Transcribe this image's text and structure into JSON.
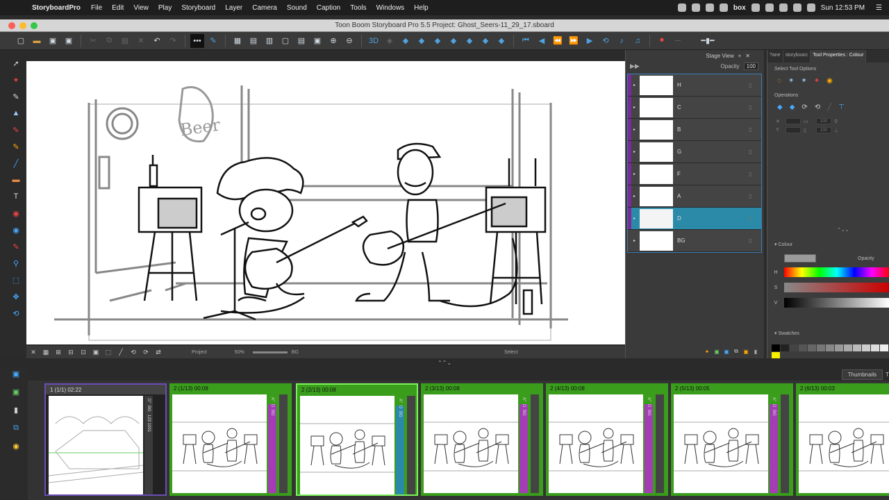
{
  "menubar": {
    "app_name": "StoryboardPro",
    "items": [
      "File",
      "Edit",
      "View",
      "Play",
      "Storyboard",
      "Layer",
      "Camera",
      "Sound",
      "Caption",
      "Tools",
      "Windows",
      "Help"
    ],
    "clock": "Sun 12:53 PM",
    "status_text": "box"
  },
  "window": {
    "title": "Toon Boom Storyboard Pro 5.5 Project: Ghost_Seers-11_29_17.sboard"
  },
  "stage_view": {
    "title": "Stage View",
    "opacity_label": "Opacity",
    "opacity_value": "100",
    "status_left": "Project",
    "zoom": "50%",
    "layer": "BG",
    "mode": "Select",
    "drawing_text": "Beer"
  },
  "layers": [
    {
      "name": "H",
      "selected": false
    },
    {
      "name": "C",
      "selected": false
    },
    {
      "name": "B",
      "selected": false
    },
    {
      "name": "G",
      "selected": false
    },
    {
      "name": "F",
      "selected": false
    },
    {
      "name": "A",
      "selected": false
    },
    {
      "name": "D",
      "selected": true
    },
    {
      "name": "BG",
      "selected": false
    }
  ],
  "right_panel": {
    "tabs": [
      "?ane",
      "storyboarc",
      "Tool Properties : Colour"
    ],
    "select_tool_options": "Select Tool Options",
    "operations": "Operations",
    "colour": "Colour",
    "opacity": "Opacity",
    "h": "H",
    "s": "S",
    "v": "V",
    "swatches": "Swatches",
    "field_value": "100"
  },
  "thumbnails_tab": "Thumbnails",
  "thumbnails_tab2": "T",
  "panels": [
    {
      "title": "1 (1/1) 02:22",
      "layers": "D\"",
      "badge": "BG",
      "count": "123 1001"
    },
    {
      "title": "2 (1/13) 00:08",
      "layers": "A\"",
      "badge": "D",
      "count": "BG"
    },
    {
      "title": "2 (2/13) 00:08",
      "layers": "A\"",
      "badge": "D",
      "count": "BG"
    },
    {
      "title": "2 (3/13) 00:08",
      "layers": "A\"",
      "badge": "D",
      "count": "BG"
    },
    {
      "title": "2 (4/13) 00:08",
      "layers": "A\"",
      "badge": "D",
      "count": "BG"
    },
    {
      "title": "2 (5/13) 00:05",
      "layers": "A\"",
      "badge": "D",
      "count": "BG"
    },
    {
      "title": "2 (6/13) 00:03",
      "layers": "A\"",
      "badge": "D",
      "count": "BG"
    }
  ],
  "colors": {
    "panel_green": "#3a9e1c",
    "selected_layer": "#2b8aa8",
    "magenta": "#a43cb6",
    "swatch_yellow": "#f5f000"
  },
  "icons": [
    "apple-icon",
    "select-arrow-icon",
    "brush-icon",
    "pencil-icon",
    "eraser-icon",
    "text-icon",
    "zoom-icon",
    "play-icon",
    "lightbulb-icon",
    "trash-icon",
    "lock-icon",
    "eye-icon"
  ]
}
